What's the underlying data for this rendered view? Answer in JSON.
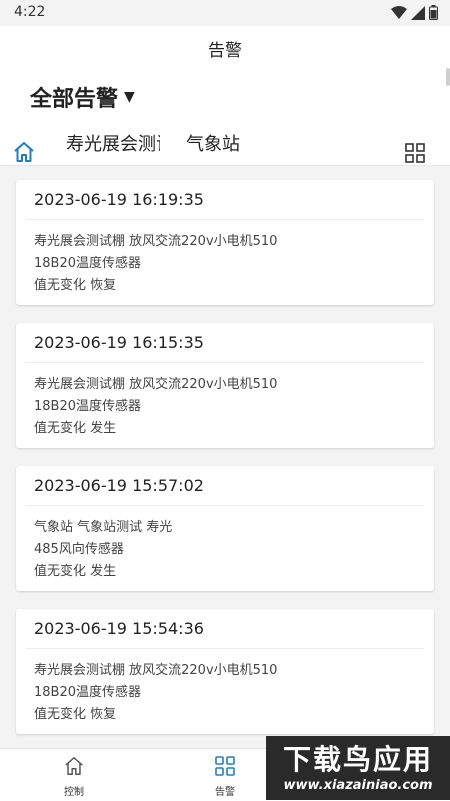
{
  "status": {
    "time": "4:22"
  },
  "header": {
    "title": "告警",
    "filter_label": "全部告警",
    "tabs": [
      {
        "label": "寿光展会测试棚"
      },
      {
        "label": "气象站"
      }
    ]
  },
  "alerts": [
    {
      "time": "2023-06-19 16:19:35",
      "line1": "寿光展会测试棚 放风交流220v小电机510",
      "line2": "18B20温度传感器",
      "line3": "值无变化 恢复"
    },
    {
      "time": "2023-06-19 16:15:35",
      "line1": "寿光展会测试棚 放风交流220v小电机510",
      "line2": "18B20温度传感器",
      "line3": "值无变化 发生"
    },
    {
      "time": "2023-06-19 15:57:02",
      "line1": "气象站 气象站测试 寿光",
      "line2": "485风向传感器",
      "line3": "值无变化 发生"
    },
    {
      "time": "2023-06-19 15:54:36",
      "line1": "寿光展会测试棚 放风交流220v小电机510",
      "line2": "18B20温度传感器",
      "line3": "值无变化 恢复"
    }
  ],
  "nav": [
    {
      "label": "控制",
      "icon": "home-icon"
    },
    {
      "label": "告警",
      "icon": "grid-icon"
    }
  ],
  "watermark": {
    "line1": "下载鸟应用",
    "line2": "www.xiazainiao.com"
  },
  "colors": {
    "accent": "#1e7fc8",
    "background": "#f3f3f3"
  }
}
